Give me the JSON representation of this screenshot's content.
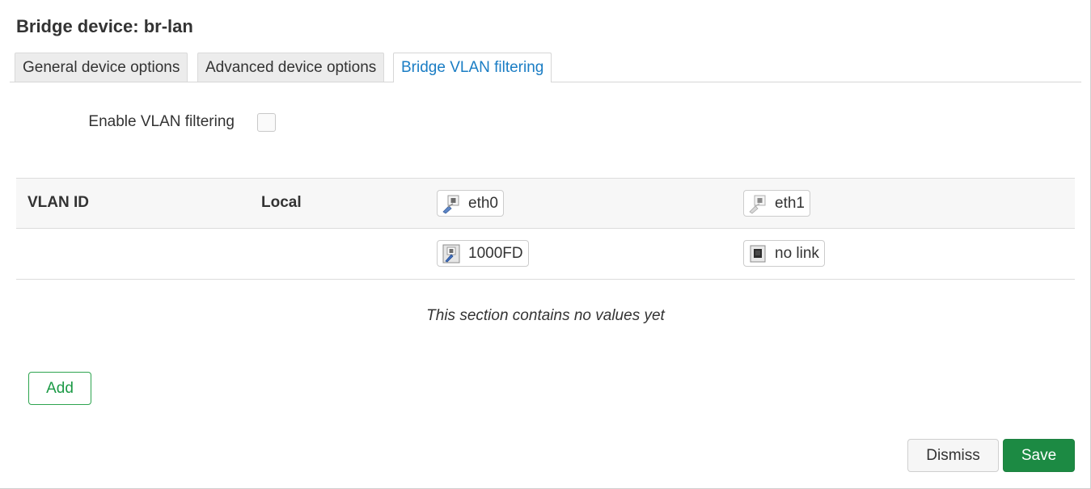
{
  "dialog": {
    "title": "Bridge device: br-lan"
  },
  "tabs": [
    {
      "label": "General device options",
      "active": false
    },
    {
      "label": "Advanced device options",
      "active": false
    },
    {
      "label": "Bridge VLAN filtering",
      "active": true
    }
  ],
  "options": {
    "enable_vlan_filtering": {
      "label": "Enable VLAN filtering",
      "checked": false
    }
  },
  "vlan_table": {
    "headers": {
      "vlan_id": "VLAN ID",
      "local": "Local"
    },
    "ports": [
      {
        "name": "eth0",
        "status": "1000FD",
        "icon": "ethernet-port-icon",
        "status_icon": "link-up-icon"
      },
      {
        "name": "eth1",
        "status": "no link",
        "icon": "ethernet-port-icon",
        "status_icon": "link-down-icon"
      }
    ],
    "empty_message": "This section contains no values yet"
  },
  "buttons": {
    "add": "Add",
    "dismiss": "Dismiss",
    "save": "Save"
  },
  "colors": {
    "active_tab_text": "#1a7dc4",
    "add_button": "#1c9a46",
    "save_button_bg": "#1c8a43"
  }
}
